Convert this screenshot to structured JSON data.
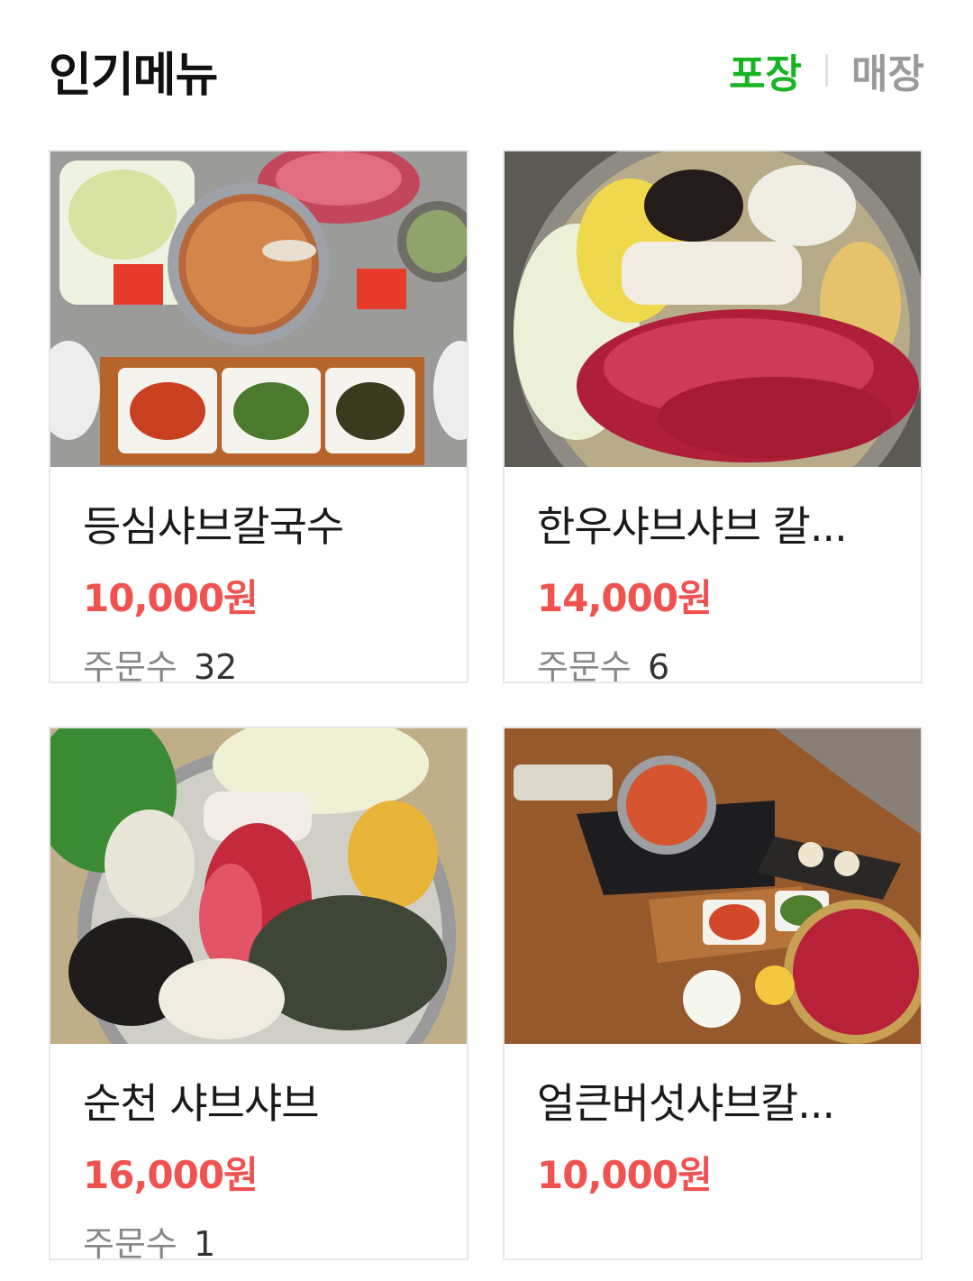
{
  "header": {
    "title": "인기메뉴",
    "tabs": [
      {
        "label": "포장",
        "active": true
      },
      {
        "label": "매장",
        "active": false
      }
    ],
    "active_color": "#19b422",
    "inactive_color": "#9a9a9a"
  },
  "menu": [
    {
      "name": "등심샤브칼국수",
      "price": "10,000원",
      "orders_label": "주문수",
      "orders": "32",
      "image": "hotpot-table-photo"
    },
    {
      "name": "한우샤브샤브 칼...",
      "price": "14,000원",
      "orders_label": "주문수",
      "orders": "6",
      "image": "beef-hotpot-photo"
    },
    {
      "name": "순천 샤브샤브",
      "price": "16,000원",
      "orders_label": "주문수",
      "orders": "1",
      "image": "crab-hotpot-photo"
    },
    {
      "name": "얼큰버섯샤브칼...",
      "price": "10,000원",
      "image": "spicy-mushroom-table-photo"
    }
  ],
  "price_color": "#f0524f"
}
